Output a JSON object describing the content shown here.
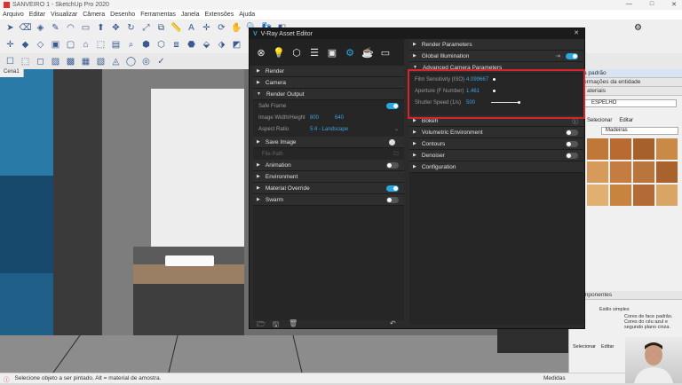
{
  "app": {
    "title": "SANVEIRO 1 - SketchUp Pro 2020"
  },
  "menu": [
    "Arquivo",
    "Editar",
    "Visualizar",
    "Câmera",
    "Desenho",
    "Ferramentas",
    "Janela",
    "Extensões",
    "Ajuda"
  ],
  "scene_tab": "Cena1",
  "status": {
    "text": "Selecione objeto a ser pintado. Alt = material de amostra.",
    "measure_label": "Medidas"
  },
  "right_panel": {
    "tray_title": "a padrão",
    "entity_info": "ormações da entidade",
    "materials_label": "ateriais",
    "material_name": "ESPELHO",
    "tab_select": "Selecionar",
    "tab_edit": "Editar",
    "category": "Madeiras",
    "components": "mponentes",
    "estilo": "Estilo simples",
    "estilo_desc": "Cores de face padrão. Cores do céu azul e segundo plano cinza."
  },
  "vray": {
    "title": "V-Ray Asset Editor",
    "left_sections": [
      {
        "label": "Render"
      },
      {
        "label": "Camera"
      },
      {
        "label": "Render Output"
      }
    ],
    "safe_frame": "Safe Frame",
    "image_size_label": "Image Width/Height",
    "image_width": "800",
    "image_height": "640",
    "aspect_label": "Aspect Ratio",
    "aspect_value": "5:4 - Landscape",
    "save_image": "Save Image",
    "file_path": "File Path",
    "left_sections_2": [
      "Animation",
      "Environment",
      "Material Override",
      "Swarm"
    ],
    "right_sections_top": [
      "Render Parameters",
      "Global Illumination"
    ],
    "advanced_camera": "Advanced Camera Parameters",
    "film_sensitivity": {
      "label": "Film Sensitivity (ISO)",
      "value": "4.099667"
    },
    "aperture": {
      "label": "Aperture (F Number)",
      "value": "1.461"
    },
    "shutter": {
      "label": "Shutter Speed (1/s)",
      "value": "500"
    },
    "right_sections_bottom": [
      "Bokeh",
      "Volumetric Environment",
      "Contours",
      "Denoiser",
      "Configuration"
    ]
  }
}
